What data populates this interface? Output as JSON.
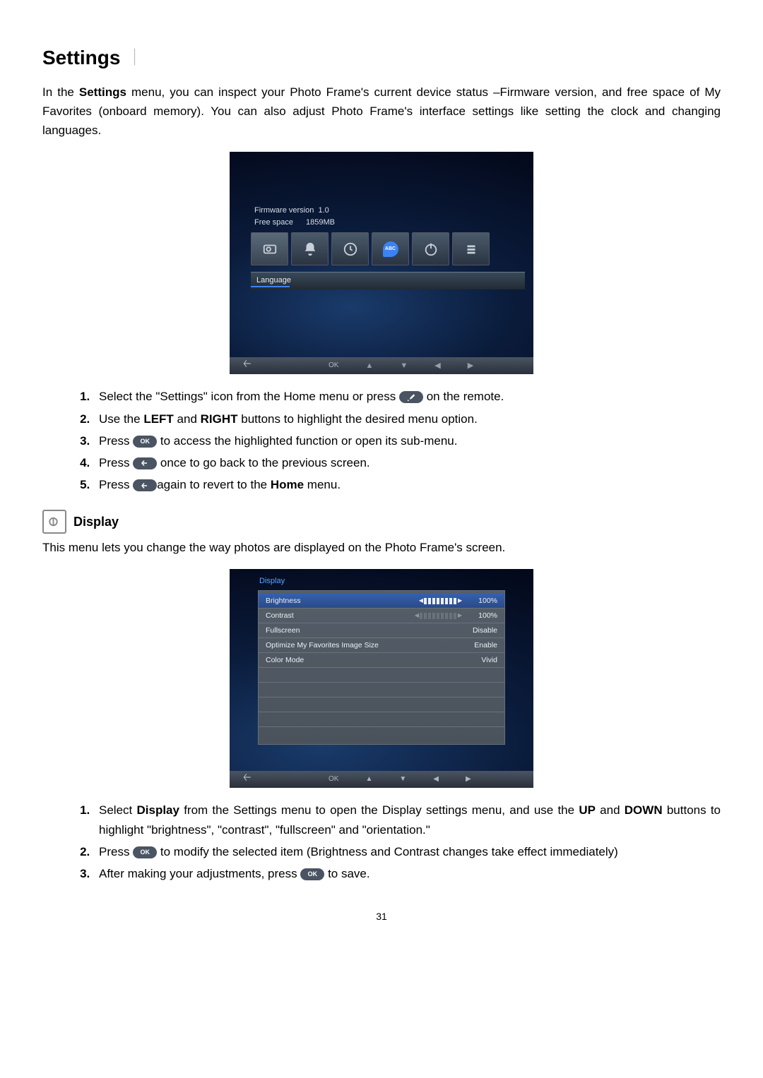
{
  "title": "Settings",
  "intro": "In the Settings menu, you can inspect your Photo Frame's current device status –Firmware version, and free space of My Favorites (onboard memory). You can also adjust Photo Frame's interface settings like setting the clock and changing languages.",
  "screenshot1": {
    "fw_label": "Firmware version",
    "fw_value": "1.0",
    "free_label": "Free space",
    "free_value": "1859MB",
    "icons": [
      "display-icon",
      "bell-icon",
      "clock-icon",
      "abc-icon",
      "power-icon",
      "system-icon"
    ],
    "selected_label": "Language",
    "foot_ok": "OK"
  },
  "steps1": [
    {
      "pre": "Select the \"Settings\" icon from the Home menu or press ",
      "pill": "tool",
      "post": " on the remote."
    },
    {
      "pre": "Use the ",
      "b1": "LEFT",
      "mid": " and ",
      "b2": "RIGHT",
      "post": " buttons to highlight the desired menu option."
    },
    {
      "pre": "Press ",
      "pill": "ok",
      "post": " to access the highlighted function or open its sub-menu."
    },
    {
      "pre": "Press ",
      "pill": "back",
      "post": " once to go back to the previous screen."
    },
    {
      "pre": "Press ",
      "pill": "back",
      "mid": "again to revert to the ",
      "b1": "Home",
      "post": " menu."
    }
  ],
  "display_heading": "Display",
  "display_intro": "This menu lets you change the way photos are displayed on the Photo Frame's screen.",
  "screenshot2": {
    "header": "Display",
    "rows": [
      {
        "label": "Brightness",
        "slider": "full",
        "value": "100%",
        "selected": true
      },
      {
        "label": "Contrast",
        "slider": "dim",
        "value": "100%"
      },
      {
        "label": "Fullscreen",
        "value": "Disable"
      },
      {
        "label": "Optimize My Favorites Image Size",
        "value": "Enable"
      },
      {
        "label": "Color Mode",
        "value": "Vivid"
      }
    ],
    "foot_ok": "OK"
  },
  "steps2": [
    {
      "pre": "Select ",
      "b1": "Display",
      "mid": " from the Settings menu to open the Display settings menu, and use the ",
      "b2": "UP",
      "mid2": " and ",
      "b3": "DOWN",
      "post": " buttons to highlight \"brightness\", \"contrast\", \"fullscreen\" and \"orientation.\""
    },
    {
      "pre": "Press ",
      "pill": "ok",
      "post": " to modify the selected item (Brightness and Contrast changes take effect immediately)"
    },
    {
      "pre": "After making your adjustments, press ",
      "pill": "ok",
      "post": " to save."
    }
  ],
  "pills": {
    "ok": "OK",
    "abc": "ABC"
  },
  "pagenum": "31"
}
